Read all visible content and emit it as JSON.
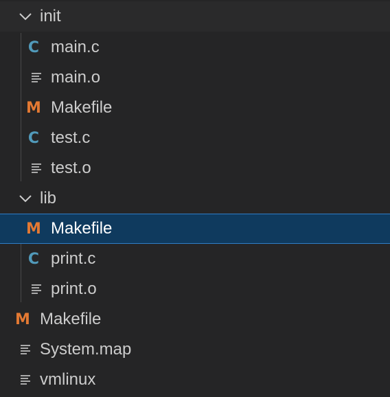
{
  "icons": {
    "folder_open": "chevron-down-icon",
    "c_file": "c-language-icon",
    "makefile": "makefile-icon",
    "plain_file": "text-lines-icon"
  },
  "colors": {
    "background": "#252526",
    "text": "#cccccc",
    "selected_background": "#0f3a5e",
    "selected_border": "#2f7ec7",
    "c_icon": "#519aba",
    "makefile_icon": "#e37933",
    "guide_line": "#4a4a4a"
  },
  "glyphs": {
    "c": "C",
    "m": "M"
  },
  "tree": {
    "init_folder": {
      "label": "init",
      "files": [
        "main.c",
        "main.o",
        "Makefile",
        "test.c",
        "test.o"
      ]
    },
    "lib_folder": {
      "label": "lib",
      "files": [
        "Makefile",
        "print.c",
        "print.o"
      ],
      "selected": "Makefile"
    },
    "root_files": [
      "Makefile",
      "System.map",
      "vmlinux"
    ]
  }
}
